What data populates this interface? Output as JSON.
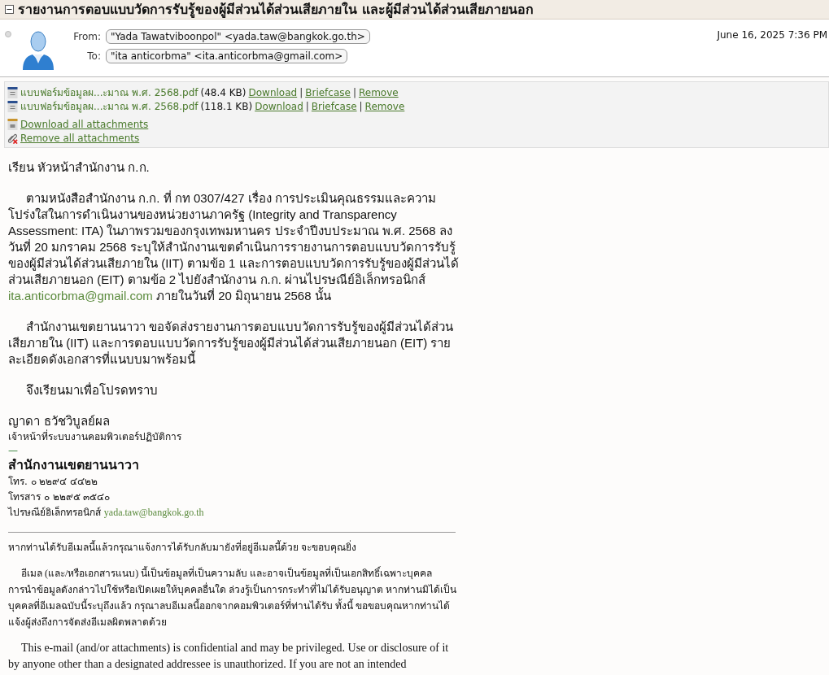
{
  "subject": {
    "title": "รายงานการตอบแบบวัดการรับรู้ของผู้มีส่วนได้ส่วนเสียภายใน และผู้มีส่วนได้ส่วนเสียภายนอก",
    "expanded": true
  },
  "header": {
    "from_label": "From:",
    "from": "\"Yada Tawatviboonpol\" <yada.taw@bangkok.go.th>",
    "to_label": "To:",
    "to": "\"ita anticorbma\" <ita.anticorbma@gmail.com>",
    "date": "June 16, 2025 7:36 PM"
  },
  "attachments": [
    {
      "name": "แบบฟอร์มข้อมูลผ...ะมาณ พ.ศ. 2568.pdf",
      "size": "(48.4 KB)",
      "actions": [
        {
          "kind": "link",
          "text": "Download"
        },
        {
          "kind": "separator",
          "text": "|"
        },
        {
          "kind": "link",
          "text": "Briefcase"
        },
        {
          "kind": "separator",
          "text": "|"
        },
        {
          "kind": "link",
          "text": "Remove"
        }
      ]
    },
    {
      "name": "แบบฟอร์มข้อมูลผ...ะมาณ พ.ศ. 2568.pdf",
      "size": "(118.1 KB)",
      "actions": [
        {
          "kind": "link",
          "text": "Download"
        },
        {
          "kind": "separator",
          "text": "|"
        },
        {
          "kind": "link",
          "text": "Briefcase"
        },
        {
          "kind": "separator",
          "text": "|"
        },
        {
          "kind": "link",
          "text": "Remove"
        }
      ]
    }
  ],
  "download_all": "Download all attachments",
  "remove_all": "Remove all attachments",
  "body": {
    "salutation": "เรียน หัวหน้าสำนักงาน ก.ก.",
    "para1_before": "ตามหนังสือสำนักงาน ก.ก. ที่ กท 0307/427 เรื่อง การประเมินคุณธรรมและความโปร่งใสในการดำเนินงานของหน่วยงานภาครัฐ (Integrity and Transparency Assessment: ITA) ในภาพรวมของกรุงเทพมหานคร ประจำปีงบประมาณ พ.ศ. 2568 ลงวันที่ 20 มกราคม 2568 ระบุให้สำนักงานเขตดำเนินการรายงานการตอบแบบวัดการรับรู้ของผู้มีส่วนได้ส่วนเสียภายใน (IIT) ตามข้อ 1 และการตอบแบบวัดการรับรู้ของผู้มีส่วนได้ส่วนเสียภายนอก (EIT) ตามข้อ 2  ไปยังสำนักงาน ก.ก. ผ่านไปรษณีย์อิเล็กทรอนิกส์",
    "para1_link": "ita.anticorbma@gmail.com",
    "para1_after": "ภายในวันที่ 20 มิถุนายน 2568  นั้น",
    "para2": "สำนักงานเขตยานนาวา ขอจัดส่งรายงานการตอบแบบวัดการรับรู้ของผู้มีส่วนได้ส่วนเสียภายใน (IIT) และการตอบแบบวัดการรับรู้ของผู้มีส่วนได้ส่วนเสียภายนอก (EIT) รายละเอียดดังเอกสารที่แนบบมาพร้อมนี้",
    "closing": "จึงเรียนมาเพื่อโปรดทราบ"
  },
  "signature": {
    "name": "ญาดา ธวัชวิบูลย์ผล",
    "position": "เจ้าหน้าที่ระบบงานคอมพิวเตอร์ปฏิบัติการ",
    "dash": "—",
    "office": "สำนักงานเขตยานนาวา",
    "phone": "โทร. ๐ ๒๒๙๔ ๔๔๒๒",
    "fax": "โทรสาร ๐  ๒๒๙๕ ๓๕๔๐",
    "email_label": "ไปรษณีย์อิเล็กทรอนิกส์",
    "email": "yada.taw@bangkok.go.th"
  },
  "disclaimer": {
    "notice": "หากท่านได้รับอีเมลนี้แล้วกรุณาแจ้งการได้รับกลับมายังที่อยู่อีเมลนี้ด้วย จะขอบคุณยิ่ง",
    "thai": "อีเมล (และ/หรือเอกสารแนบ) นี้เป็นข้อมูลที่เป็นความลับ และอาจเป็นข้อมูลที่เป็นเอกสิทธิ์เฉพาะบุคคล การนำข้อมูลดังกล่าวไปใช้หรือเปิดเผยให้บุคคลอื่นใด ล่วงรู้เป็นการกระทำที่ไม่ได้รับอนุญาต หากท่านมิได้เป็นบุคคลที่อีเมลฉบับนี้ระบุถึงแล้ว กรุณาลบอีเมลนี้ออกจากคอมพิวเตอร์ที่ท่านได้รับ ทั้งนี้ ขอขอบคุณหากท่านได้แจ้งผู้ส่งถึงการจัดส่งอีเมลผิดพลาดด้วย",
    "english": "This e-mail (and/or attachments) is confidential and may be privileged. Use or disclosure of it by anyone other than a designated addressee is unauthorized. If you are not an intended"
  }
}
